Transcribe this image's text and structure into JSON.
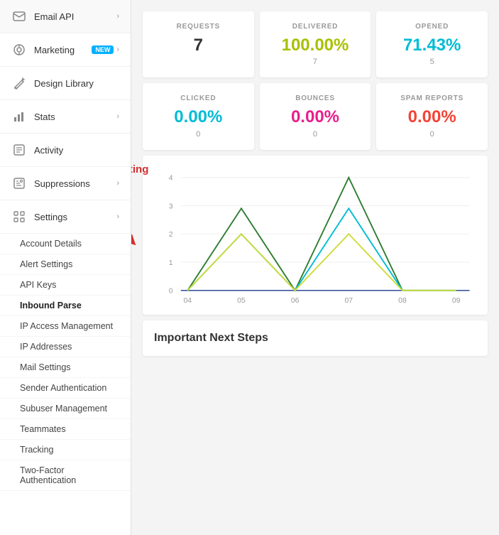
{
  "sidebar": {
    "nav_items": [
      {
        "id": "email-api",
        "label": "Email API",
        "icon": "✉",
        "has_chevron": true
      },
      {
        "id": "marketing",
        "label": "Marketing",
        "icon": "📢",
        "has_chevron": true,
        "badge": "NEW"
      },
      {
        "id": "design-library",
        "label": "Design Library",
        "icon": "✂",
        "has_chevron": false
      },
      {
        "id": "stats",
        "label": "Stats",
        "icon": "📊",
        "has_chevron": true
      },
      {
        "id": "activity",
        "label": "Activity",
        "icon": "📋",
        "has_chevron": false
      },
      {
        "id": "suppressions",
        "label": "Suppressions",
        "icon": "🚫",
        "has_chevron": true
      },
      {
        "id": "settings",
        "label": "Settings",
        "icon": "⚙",
        "has_chevron": true
      }
    ],
    "settings_sub_items": [
      {
        "id": "account-details",
        "label": "Account Details",
        "active": false
      },
      {
        "id": "alert-settings",
        "label": "Alert Settings",
        "active": false
      },
      {
        "id": "api-keys",
        "label": "API Keys",
        "active": false
      },
      {
        "id": "inbound-parse",
        "label": "Inbound Parse",
        "active": true
      },
      {
        "id": "ip-access-management",
        "label": "IP Access Management",
        "active": false
      },
      {
        "id": "ip-addresses",
        "label": "IP Addresses",
        "active": false
      },
      {
        "id": "mail-settings",
        "label": "Mail Settings",
        "active": false
      },
      {
        "id": "sender-authentication",
        "label": "Sender Authentication",
        "active": false
      },
      {
        "id": "subuser-management",
        "label": "Subuser Management",
        "active": false
      },
      {
        "id": "teammates",
        "label": "Teammates",
        "active": false
      },
      {
        "id": "tracking",
        "label": "Tracking",
        "active": false
      },
      {
        "id": "two-factor",
        "label": "Two-Factor Authentication",
        "active": false
      }
    ]
  },
  "stats": {
    "requests": {
      "label": "REQUESTS",
      "value": "7",
      "sub": ""
    },
    "delivered": {
      "label": "DELIVERED",
      "value": "100.00%",
      "sub": "7",
      "color": "green"
    },
    "opened": {
      "label": "OPENED",
      "value": "71.43%",
      "sub": "5",
      "color": "teal"
    },
    "clicked": {
      "label": "CLICKED",
      "value": "0.00%",
      "sub": "0",
      "color": "cyan"
    },
    "bounces": {
      "label": "BOUNCES",
      "value": "0.00%",
      "sub": "0",
      "color": "pink"
    },
    "spam_reports": {
      "label": "SPAM REPORTS",
      "value": "0.00%",
      "sub": "0",
      "color": "red"
    }
  },
  "annotation": {
    "text": "Select this for creating an API Key",
    "arrow": "↙"
  },
  "chart": {
    "y_labels": [
      "0",
      "1",
      "2",
      "3",
      "4"
    ],
    "x_labels": [
      "04",
      "05",
      "06",
      "07",
      "08",
      "09"
    ]
  },
  "next_steps": {
    "title": "Important Next Steps"
  }
}
